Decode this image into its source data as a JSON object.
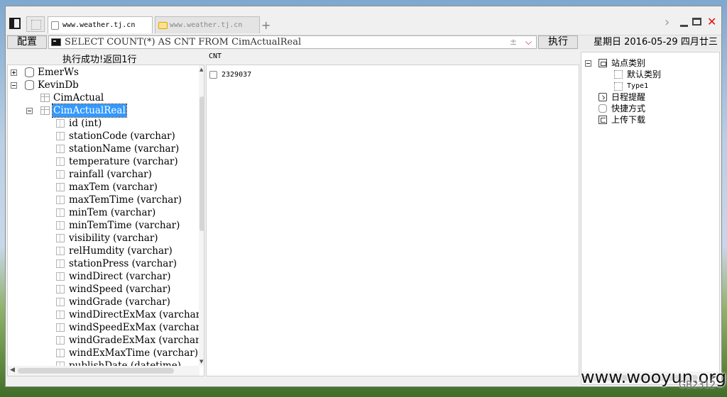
{
  "tabs": [
    {
      "label": "www.weather.tj.cn",
      "active": true
    },
    {
      "label": "www.weather.tj.cn",
      "active": false
    }
  ],
  "tab_add_label": "+",
  "toolbar": {
    "config_label": "配置",
    "query_value": "SELECT COUNT(*) AS CNT FROM CimActualReal",
    "query_plusminus": "±",
    "execute_label": "执行",
    "date": "星期日 2016-05-29 四月廿三"
  },
  "status_message": "执行成功!返回1行",
  "result": {
    "columns": [
      "CNT"
    ],
    "rows": [
      [
        "2329037"
      ]
    ]
  },
  "db_tree": {
    "databases": [
      {
        "name": "EmerWs",
        "expanded": false
      },
      {
        "name": "KevinDb",
        "expanded": true
      }
    ],
    "tables": [
      {
        "name": "CimActual",
        "expanded": false,
        "selected": false
      },
      {
        "name": "CimActualReal",
        "expanded": true,
        "selected": true
      }
    ],
    "columns": [
      "id (int)",
      "stationCode (varchar)",
      "stationName (varchar)",
      "temperature (varchar)",
      "rainfall (varchar)",
      "maxTem (varchar)",
      "maxTemTime (varchar)",
      "minTem (varchar)",
      "minTemTime (varchar)",
      "visibility (varchar)",
      "relHumdity (varchar)",
      "stationPress (varchar)",
      "windDirect (varchar)",
      "windSpeed (varchar)",
      "windGrade (varchar)",
      "windDirectExMax (varchar)",
      "windSpeedExMax (varchar)",
      "windGradeExMax (varchar)",
      "windExMaxTime (varchar)",
      "publishDate (datetime)"
    ]
  },
  "side_tree": {
    "category_label": "站点类别",
    "category_children": [
      "默认类别",
      "Type1"
    ],
    "items": [
      "日程提醒",
      "快捷方式",
      "上传下载"
    ]
  },
  "watermark": "www.wooyun.org",
  "encoding": "GB2312",
  "colors": {
    "selection": "#3399ff",
    "close": "#dd1111"
  }
}
